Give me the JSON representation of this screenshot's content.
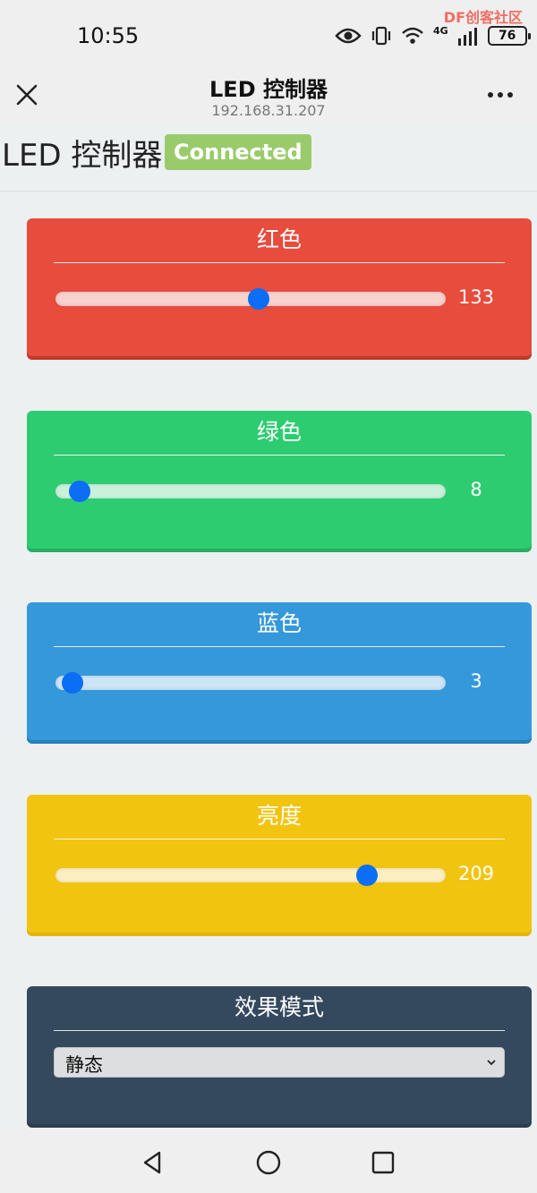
{
  "status_bar": {
    "time": "10:55",
    "battery": "76",
    "network": "4G",
    "watermark": "DF创客社区",
    "icons": [
      "eye-icon",
      "vibrate-icon",
      "wifi-icon",
      "signal-icon",
      "battery-icon"
    ]
  },
  "title_bar": {
    "title": "LED 控制器",
    "subtitle": "192.168.31.207",
    "close_icon": "close-icon",
    "more_icon": "more-icon"
  },
  "page": {
    "title": "LED 控制器",
    "status": "Connected",
    "status_color": "#9acb6b"
  },
  "controls": [
    {
      "label": "红色",
      "value": "133",
      "max": 255,
      "color": "#e74c3c",
      "bottom": "#c0392b"
    },
    {
      "label": "绿色",
      "value": "8",
      "max": 255,
      "color": "#2ecc71",
      "bottom": "#27ae60"
    },
    {
      "label": "蓝色",
      "value": "3",
      "max": 255,
      "color": "#3498db",
      "bottom": "#2980b9"
    },
    {
      "label": "亮度",
      "value": "209",
      "max": 255,
      "color": "#f1c40f",
      "bottom": "#e2b709"
    }
  ],
  "effect": {
    "label": "效果模式",
    "selected": "静态",
    "color": "#34495e"
  },
  "nav": {
    "back_icon": "back-icon",
    "home_icon": "home-icon",
    "recents_icon": "recents-icon"
  }
}
